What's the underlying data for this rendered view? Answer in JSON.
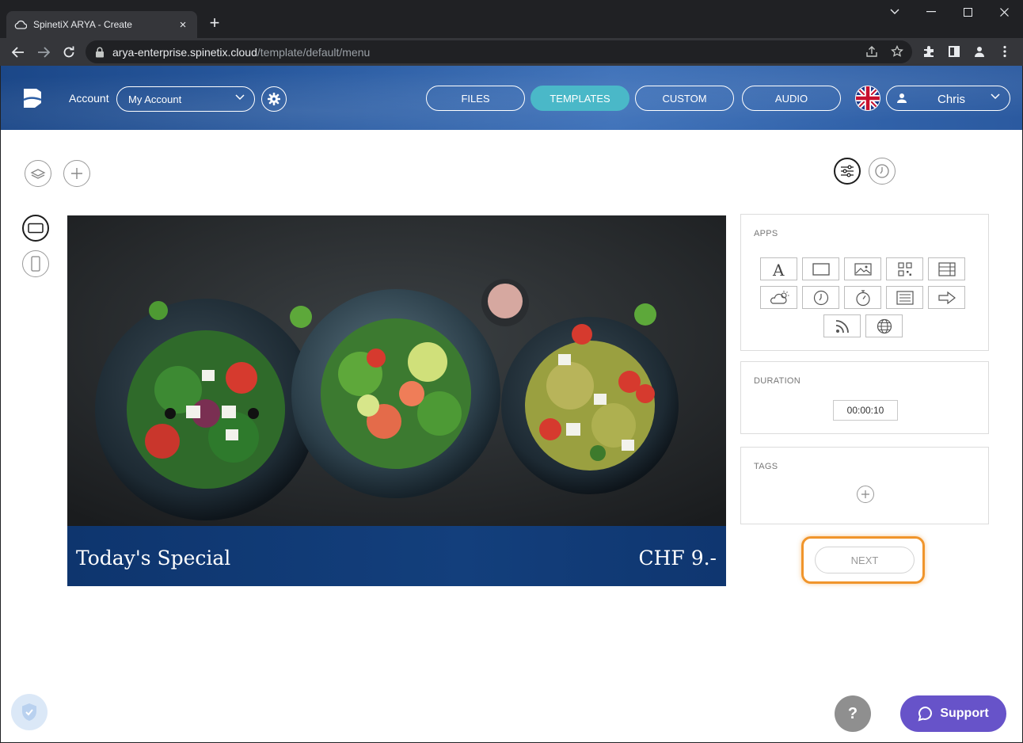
{
  "browser": {
    "tab_title": "SpinetiX ARYA - Create",
    "tab_close": "×",
    "new_tab": "+",
    "url_host": "arya-enterprise.spinetix.cloud",
    "url_path": "/template/default/menu",
    "icons": [
      "cloud-icon",
      "back-icon",
      "forward-icon",
      "reload-icon",
      "lock-icon",
      "share-icon",
      "star-icon",
      "extensions-icon",
      "sidepanel-icon",
      "profile-icon",
      "menu-icon"
    ]
  },
  "header": {
    "account_label": "Account",
    "account_value": "My Account",
    "nav": [
      {
        "label": "FILES",
        "active": false
      },
      {
        "label": "TEMPLATES",
        "active": true
      },
      {
        "label": "CUSTOM",
        "active": false
      },
      {
        "label": "AUDIO",
        "active": false
      }
    ],
    "language_flag": "uk-flag-icon",
    "user_name": "Chris"
  },
  "preview": {
    "title": "Today's Special",
    "price": "CHF 9.-"
  },
  "sidebar": {
    "apps_title": "APPS",
    "apps": [
      "text-icon",
      "shape-icon",
      "image-icon",
      "qrcode-icon",
      "table-icon",
      "weather-icon",
      "clock-icon",
      "timer-icon",
      "list-icon",
      "arrow-icon",
      "rss-icon",
      "web-icon"
    ],
    "duration_title": "DURATION",
    "duration_value": "00:00:10",
    "tags_title": "TAGS",
    "next_label": "NEXT"
  },
  "footer": {
    "help_label": "?",
    "support_label": "Support"
  },
  "colors": {
    "active_nav": "#4ab8c8",
    "header_blue": "#2c5ea5",
    "highlight_orange": "#f0952c",
    "support_purple": "#6753c9",
    "banner_navy": "#0e356e"
  }
}
